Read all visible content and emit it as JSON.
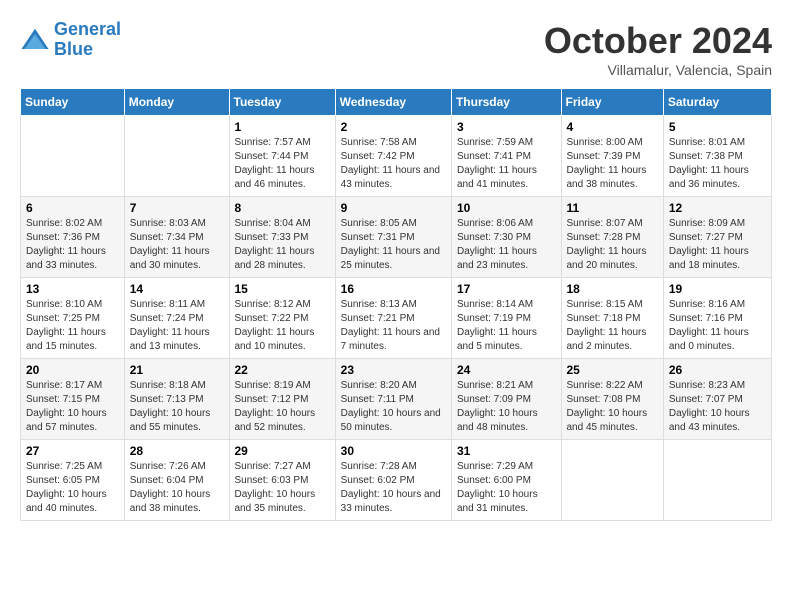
{
  "header": {
    "logo_line1": "General",
    "logo_line2": "Blue",
    "month": "October 2024",
    "location": "Villamalur, Valencia, Spain"
  },
  "weekdays": [
    "Sunday",
    "Monday",
    "Tuesday",
    "Wednesday",
    "Thursday",
    "Friday",
    "Saturday"
  ],
  "weeks": [
    [
      {
        "day": "",
        "sunrise": "",
        "sunset": "",
        "daylight": ""
      },
      {
        "day": "",
        "sunrise": "",
        "sunset": "",
        "daylight": ""
      },
      {
        "day": "1",
        "sunrise": "Sunrise: 7:57 AM",
        "sunset": "Sunset: 7:44 PM",
        "daylight": "Daylight: 11 hours and 46 minutes."
      },
      {
        "day": "2",
        "sunrise": "Sunrise: 7:58 AM",
        "sunset": "Sunset: 7:42 PM",
        "daylight": "Daylight: 11 hours and 43 minutes."
      },
      {
        "day": "3",
        "sunrise": "Sunrise: 7:59 AM",
        "sunset": "Sunset: 7:41 PM",
        "daylight": "Daylight: 11 hours and 41 minutes."
      },
      {
        "day": "4",
        "sunrise": "Sunrise: 8:00 AM",
        "sunset": "Sunset: 7:39 PM",
        "daylight": "Daylight: 11 hours and 38 minutes."
      },
      {
        "day": "5",
        "sunrise": "Sunrise: 8:01 AM",
        "sunset": "Sunset: 7:38 PM",
        "daylight": "Daylight: 11 hours and 36 minutes."
      }
    ],
    [
      {
        "day": "6",
        "sunrise": "Sunrise: 8:02 AM",
        "sunset": "Sunset: 7:36 PM",
        "daylight": "Daylight: 11 hours and 33 minutes."
      },
      {
        "day": "7",
        "sunrise": "Sunrise: 8:03 AM",
        "sunset": "Sunset: 7:34 PM",
        "daylight": "Daylight: 11 hours and 30 minutes."
      },
      {
        "day": "8",
        "sunrise": "Sunrise: 8:04 AM",
        "sunset": "Sunset: 7:33 PM",
        "daylight": "Daylight: 11 hours and 28 minutes."
      },
      {
        "day": "9",
        "sunrise": "Sunrise: 8:05 AM",
        "sunset": "Sunset: 7:31 PM",
        "daylight": "Daylight: 11 hours and 25 minutes."
      },
      {
        "day": "10",
        "sunrise": "Sunrise: 8:06 AM",
        "sunset": "Sunset: 7:30 PM",
        "daylight": "Daylight: 11 hours and 23 minutes."
      },
      {
        "day": "11",
        "sunrise": "Sunrise: 8:07 AM",
        "sunset": "Sunset: 7:28 PM",
        "daylight": "Daylight: 11 hours and 20 minutes."
      },
      {
        "day": "12",
        "sunrise": "Sunrise: 8:09 AM",
        "sunset": "Sunset: 7:27 PM",
        "daylight": "Daylight: 11 hours and 18 minutes."
      }
    ],
    [
      {
        "day": "13",
        "sunrise": "Sunrise: 8:10 AM",
        "sunset": "Sunset: 7:25 PM",
        "daylight": "Daylight: 11 hours and 15 minutes."
      },
      {
        "day": "14",
        "sunrise": "Sunrise: 8:11 AM",
        "sunset": "Sunset: 7:24 PM",
        "daylight": "Daylight: 11 hours and 13 minutes."
      },
      {
        "day": "15",
        "sunrise": "Sunrise: 8:12 AM",
        "sunset": "Sunset: 7:22 PM",
        "daylight": "Daylight: 11 hours and 10 minutes."
      },
      {
        "day": "16",
        "sunrise": "Sunrise: 8:13 AM",
        "sunset": "Sunset: 7:21 PM",
        "daylight": "Daylight: 11 hours and 7 minutes."
      },
      {
        "day": "17",
        "sunrise": "Sunrise: 8:14 AM",
        "sunset": "Sunset: 7:19 PM",
        "daylight": "Daylight: 11 hours and 5 minutes."
      },
      {
        "day": "18",
        "sunrise": "Sunrise: 8:15 AM",
        "sunset": "Sunset: 7:18 PM",
        "daylight": "Daylight: 11 hours and 2 minutes."
      },
      {
        "day": "19",
        "sunrise": "Sunrise: 8:16 AM",
        "sunset": "Sunset: 7:16 PM",
        "daylight": "Daylight: 11 hours and 0 minutes."
      }
    ],
    [
      {
        "day": "20",
        "sunrise": "Sunrise: 8:17 AM",
        "sunset": "Sunset: 7:15 PM",
        "daylight": "Daylight: 10 hours and 57 minutes."
      },
      {
        "day": "21",
        "sunrise": "Sunrise: 8:18 AM",
        "sunset": "Sunset: 7:13 PM",
        "daylight": "Daylight: 10 hours and 55 minutes."
      },
      {
        "day": "22",
        "sunrise": "Sunrise: 8:19 AM",
        "sunset": "Sunset: 7:12 PM",
        "daylight": "Daylight: 10 hours and 52 minutes."
      },
      {
        "day": "23",
        "sunrise": "Sunrise: 8:20 AM",
        "sunset": "Sunset: 7:11 PM",
        "daylight": "Daylight: 10 hours and 50 minutes."
      },
      {
        "day": "24",
        "sunrise": "Sunrise: 8:21 AM",
        "sunset": "Sunset: 7:09 PM",
        "daylight": "Daylight: 10 hours and 48 minutes."
      },
      {
        "day": "25",
        "sunrise": "Sunrise: 8:22 AM",
        "sunset": "Sunset: 7:08 PM",
        "daylight": "Daylight: 10 hours and 45 minutes."
      },
      {
        "day": "26",
        "sunrise": "Sunrise: 8:23 AM",
        "sunset": "Sunset: 7:07 PM",
        "daylight": "Daylight: 10 hours and 43 minutes."
      }
    ],
    [
      {
        "day": "27",
        "sunrise": "Sunrise: 7:25 AM",
        "sunset": "Sunset: 6:05 PM",
        "daylight": "Daylight: 10 hours and 40 minutes."
      },
      {
        "day": "28",
        "sunrise": "Sunrise: 7:26 AM",
        "sunset": "Sunset: 6:04 PM",
        "daylight": "Daylight: 10 hours and 38 minutes."
      },
      {
        "day": "29",
        "sunrise": "Sunrise: 7:27 AM",
        "sunset": "Sunset: 6:03 PM",
        "daylight": "Daylight: 10 hours and 35 minutes."
      },
      {
        "day": "30",
        "sunrise": "Sunrise: 7:28 AM",
        "sunset": "Sunset: 6:02 PM",
        "daylight": "Daylight: 10 hours and 33 minutes."
      },
      {
        "day": "31",
        "sunrise": "Sunrise: 7:29 AM",
        "sunset": "Sunset: 6:00 PM",
        "daylight": "Daylight: 10 hours and 31 minutes."
      },
      {
        "day": "",
        "sunrise": "",
        "sunset": "",
        "daylight": ""
      },
      {
        "day": "",
        "sunrise": "",
        "sunset": "",
        "daylight": ""
      }
    ]
  ]
}
